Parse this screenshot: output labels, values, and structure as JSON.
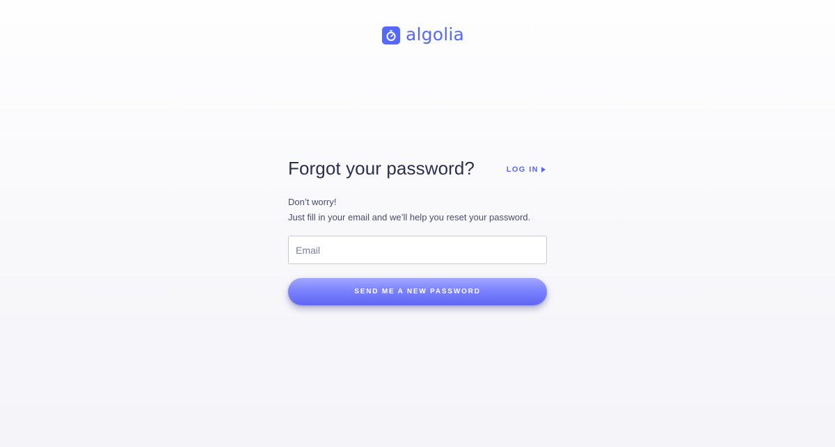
{
  "brand": {
    "name": "algolia",
    "logo_icon": "stopwatch-icon",
    "color": "#5468ff"
  },
  "form": {
    "title": "Forgot your password?",
    "login_link": "LOG IN",
    "login_icon": "triangle-right-icon",
    "desc_line1": "Don’t worry!",
    "desc_line2": "Just fill in your email and we’ll help you reset your password.",
    "email_placeholder": "Email",
    "email_value": "",
    "submit_label": "SEND ME A NEW PASSWORD"
  },
  "colors": {
    "accent": "#5468ff",
    "text": "#2a2f4f",
    "input_border": "#c6c9de"
  }
}
